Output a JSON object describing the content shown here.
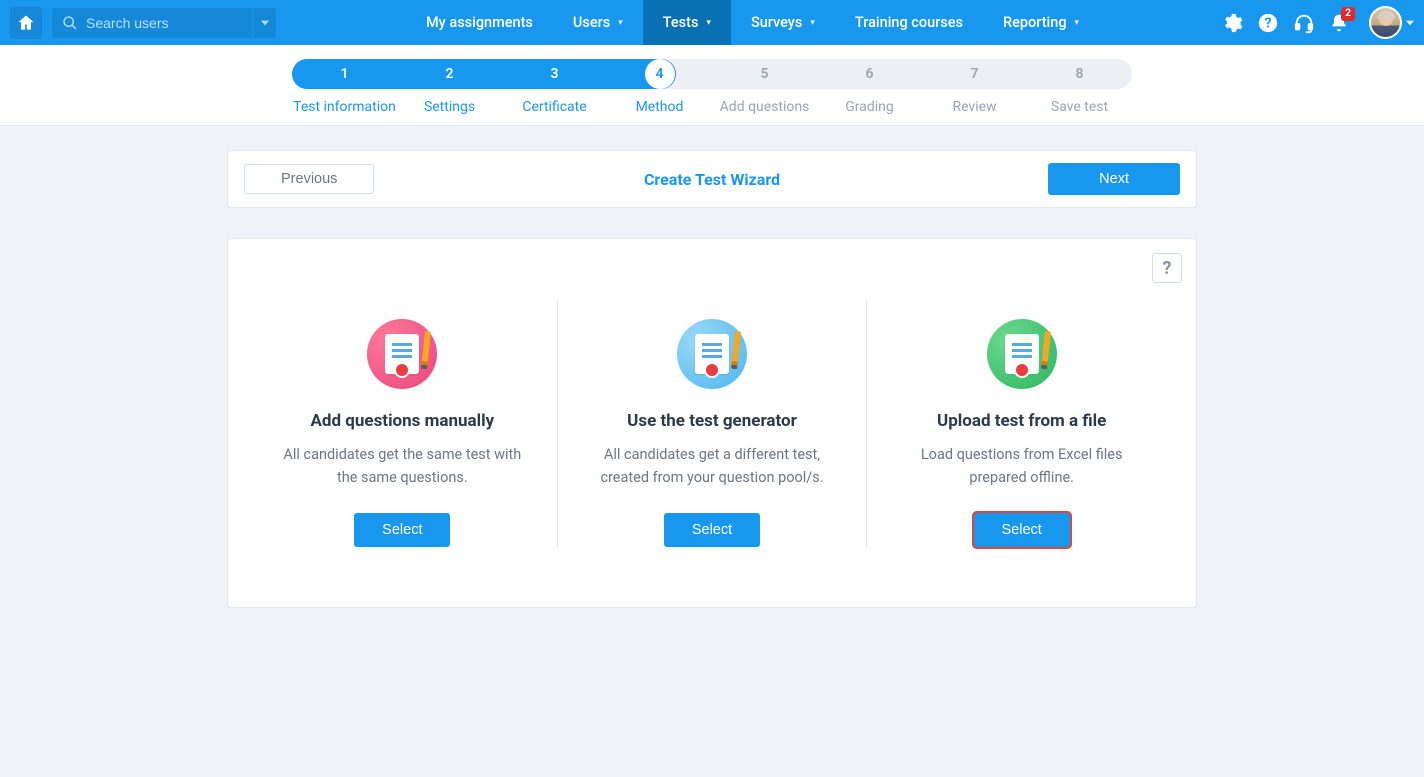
{
  "topbar": {
    "search_placeholder": "Search users",
    "nav": [
      {
        "label": "My assignments",
        "dropdown": false,
        "active": false
      },
      {
        "label": "Users",
        "dropdown": true,
        "active": false
      },
      {
        "label": "Tests",
        "dropdown": true,
        "active": true
      },
      {
        "label": "Surveys",
        "dropdown": true,
        "active": false
      },
      {
        "label": "Training courses",
        "dropdown": false,
        "active": false
      },
      {
        "label": "Reporting",
        "dropdown": true,
        "active": false
      }
    ],
    "notification_count": "2"
  },
  "stepper": {
    "current_index": 3,
    "steps": [
      {
        "num": "1",
        "label": "Test information"
      },
      {
        "num": "2",
        "label": "Settings"
      },
      {
        "num": "3",
        "label": "Certificate"
      },
      {
        "num": "4",
        "label": "Method"
      },
      {
        "num": "5",
        "label": "Add questions"
      },
      {
        "num": "6",
        "label": "Grading"
      },
      {
        "num": "7",
        "label": "Review"
      },
      {
        "num": "8",
        "label": "Save test"
      }
    ]
  },
  "wizard": {
    "title": "Create Test Wizard",
    "previous_label": "Previous",
    "next_label": "Next",
    "help_label": "?"
  },
  "options": [
    {
      "title": "Add questions manually",
      "desc": "All candidates get the same test with the same questions.",
      "select_label": "Select",
      "highlighted": false,
      "icon_variant": "pink"
    },
    {
      "title": "Use the test generator",
      "desc": "All candidates get a different test, created from your question pool/s.",
      "select_label": "Select",
      "highlighted": false,
      "icon_variant": "blue"
    },
    {
      "title": "Upload test from a file",
      "desc": "Load questions from Excel files prepared offline.",
      "select_label": "Select",
      "highlighted": true,
      "icon_variant": "green"
    }
  ]
}
